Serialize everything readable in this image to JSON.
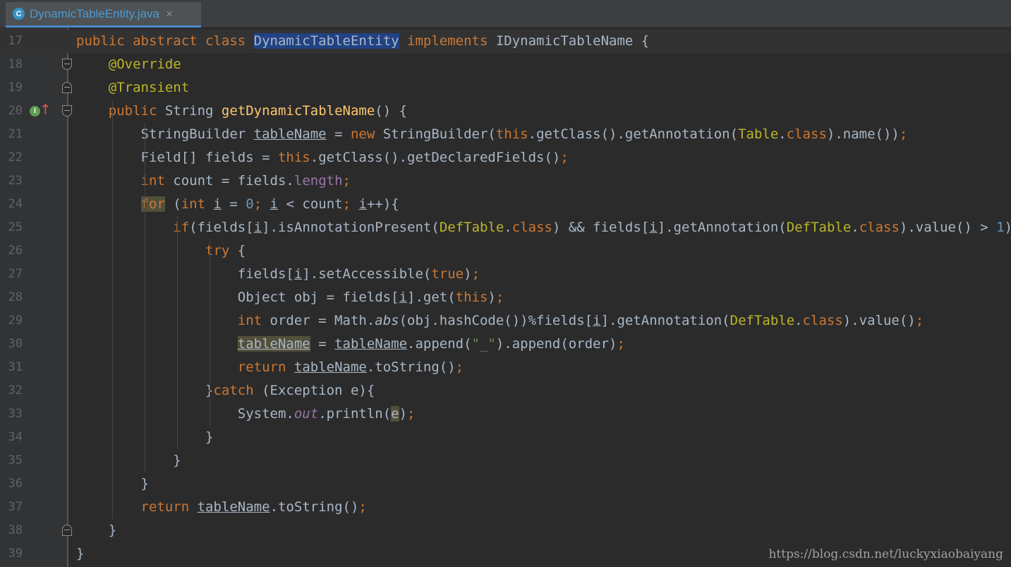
{
  "tab": {
    "icon": "C",
    "filename": "DynamicTableEntity.java",
    "close": "×"
  },
  "colors": {
    "keyword": "#cc7832",
    "annotation": "#bbb529",
    "method_declaration": "#ffc66d",
    "field": "#9876aa",
    "number": "#6897bb",
    "string": "#6a8759",
    "text": "#a9b7c6",
    "background": "#2b2b2b",
    "gutter": "#313335"
  },
  "gutter_icons": {
    "line_20": [
      "implements-interface-icon",
      "go-to-super-method-icon"
    ]
  },
  "watermark": "https://blog.csdn.net/luckyxiaobaiyang",
  "lines": [
    {
      "num": "17",
      "fold": null,
      "tokens": [
        [
          "kw",
          "public abstract class "
        ],
        [
          "hl",
          "DynamicTableEntity"
        ],
        [
          "t",
          " "
        ],
        [
          "kw",
          "implements"
        ],
        [
          "t",
          " IDynamicTableName {"
        ]
      ]
    },
    {
      "num": "18",
      "fold": "open",
      "tokens": [
        [
          "t",
          "    "
        ],
        [
          "ann",
          "@Override"
        ]
      ]
    },
    {
      "num": "19",
      "fold": "close",
      "tokens": [
        [
          "t",
          "    "
        ],
        [
          "ann",
          "@Transient"
        ]
      ]
    },
    {
      "num": "20",
      "fold": "open",
      "tokens": [
        [
          "t",
          "    "
        ],
        [
          "kw",
          "public"
        ],
        [
          "t",
          " String "
        ],
        [
          "mdecl",
          "getDynamicTableName"
        ],
        [
          "t",
          "() {"
        ]
      ]
    },
    {
      "num": "21",
      "fold": null,
      "tokens": [
        [
          "t",
          "        StringBuilder "
        ],
        [
          "ul",
          "tableName"
        ],
        [
          "t",
          " = "
        ],
        [
          "kw",
          "new"
        ],
        [
          "t",
          " StringBuilder("
        ],
        [
          "kw",
          "this"
        ],
        [
          "t",
          ".getClass().getAnnotation("
        ],
        [
          "ann",
          "Table"
        ],
        [
          "t",
          "."
        ],
        [
          "kw",
          "class"
        ],
        [
          "t",
          ").name())"
        ],
        [
          "kw",
          ";"
        ]
      ]
    },
    {
      "num": "22",
      "fold": null,
      "tokens": [
        [
          "t",
          "        Field[] fields = "
        ],
        [
          "kw",
          "this"
        ],
        [
          "t",
          ".getClass().getDeclaredFields()"
        ],
        [
          "kw",
          ";"
        ]
      ]
    },
    {
      "num": "23",
      "fold": null,
      "tokens": [
        [
          "t",
          "        "
        ],
        [
          "kw",
          "int"
        ],
        [
          "t",
          " count = fields."
        ],
        [
          "fld",
          "length"
        ],
        [
          "kw",
          ";"
        ]
      ]
    },
    {
      "num": "24",
      "fold": null,
      "tokens": [
        [
          "t",
          "        "
        ],
        [
          "kwocc",
          "for"
        ],
        [
          "t",
          " ("
        ],
        [
          "kw",
          "int"
        ],
        [
          "t",
          " "
        ],
        [
          "ul",
          "i"
        ],
        [
          "t",
          " = "
        ],
        [
          "num",
          "0"
        ],
        [
          "kw",
          "; "
        ],
        [
          "ul",
          "i"
        ],
        [
          "t",
          " < count"
        ],
        [
          "kw",
          "; "
        ],
        [
          "ul",
          "i"
        ],
        [
          "t",
          "++){"
        ]
      ]
    },
    {
      "num": "25",
      "fold": null,
      "tokens": [
        [
          "t",
          "            "
        ],
        [
          "kw",
          "if"
        ],
        [
          "t",
          "(fields["
        ],
        [
          "ul",
          "i"
        ],
        [
          "t",
          "].isAnnotationPresent("
        ],
        [
          "ann",
          "DefTable"
        ],
        [
          "t",
          "."
        ],
        [
          "kw",
          "class"
        ],
        [
          "t",
          ") && fields["
        ],
        [
          "ul",
          "i"
        ],
        [
          "t",
          "].getAnnotation("
        ],
        [
          "ann",
          "DefTable"
        ],
        [
          "t",
          "."
        ],
        [
          "kw",
          "class"
        ],
        [
          "t",
          ").value() > "
        ],
        [
          "num",
          "1"
        ],
        [
          "t",
          "){"
        ]
      ]
    },
    {
      "num": "26",
      "fold": null,
      "tokens": [
        [
          "t",
          "                "
        ],
        [
          "kw",
          "try"
        ],
        [
          "t",
          " {"
        ]
      ]
    },
    {
      "num": "27",
      "fold": null,
      "tokens": [
        [
          "t",
          "                    fields["
        ],
        [
          "ul",
          "i"
        ],
        [
          "t",
          "].setAccessible("
        ],
        [
          "kw",
          "true"
        ],
        [
          "t",
          ")"
        ],
        [
          "kw",
          ";"
        ]
      ]
    },
    {
      "num": "28",
      "fold": null,
      "tokens": [
        [
          "t",
          "                    Object obj = fields["
        ],
        [
          "ul",
          "i"
        ],
        [
          "t",
          "].get("
        ],
        [
          "kw",
          "this"
        ],
        [
          "t",
          ")"
        ],
        [
          "kw",
          ";"
        ]
      ]
    },
    {
      "num": "29",
      "fold": null,
      "tokens": [
        [
          "t",
          "                    "
        ],
        [
          "kw",
          "int"
        ],
        [
          "t",
          " order = Math."
        ],
        [
          "smeth",
          "abs"
        ],
        [
          "t",
          "(obj.hashCode())%fields["
        ],
        [
          "ul",
          "i"
        ],
        [
          "t",
          "].getAnnotation("
        ],
        [
          "ann",
          "DefTable"
        ],
        [
          "t",
          "."
        ],
        [
          "kw",
          "class"
        ],
        [
          "t",
          ").value()"
        ],
        [
          "kw",
          ";"
        ]
      ]
    },
    {
      "num": "30",
      "fold": null,
      "tokens": [
        [
          "t",
          "                    "
        ],
        [
          "ulocc",
          "tableName"
        ],
        [
          "t",
          " = "
        ],
        [
          "ul",
          "tableName"
        ],
        [
          "t",
          ".append("
        ],
        [
          "str",
          "\"_\""
        ],
        [
          "t",
          ").append(order)"
        ],
        [
          "kw",
          ";"
        ]
      ]
    },
    {
      "num": "31",
      "fold": null,
      "tokens": [
        [
          "t",
          "                    "
        ],
        [
          "kw",
          "return"
        ],
        [
          "t",
          " "
        ],
        [
          "ul",
          "tableName"
        ],
        [
          "t",
          ".toString()"
        ],
        [
          "kw",
          ";"
        ]
      ]
    },
    {
      "num": "32",
      "fold": null,
      "tokens": [
        [
          "t",
          "                }"
        ],
        [
          "kw",
          "catch"
        ],
        [
          "t",
          " (Exception e){"
        ]
      ]
    },
    {
      "num": "33",
      "fold": null,
      "tokens": [
        [
          "t",
          "                    System."
        ],
        [
          "sfld",
          "out"
        ],
        [
          "t",
          ".println("
        ],
        [
          "occ",
          "e"
        ],
        [
          "t",
          ")"
        ],
        [
          "kw",
          ";"
        ]
      ]
    },
    {
      "num": "34",
      "fold": null,
      "tokens": [
        [
          "t",
          "                }"
        ]
      ]
    },
    {
      "num": "35",
      "fold": null,
      "tokens": [
        [
          "t",
          "            }"
        ]
      ]
    },
    {
      "num": "36",
      "fold": null,
      "tokens": [
        [
          "t",
          "        }"
        ]
      ]
    },
    {
      "num": "37",
      "fold": null,
      "tokens": [
        [
          "t",
          "        "
        ],
        [
          "kw",
          "return"
        ],
        [
          "t",
          " "
        ],
        [
          "ul",
          "tableName"
        ],
        [
          "t",
          ".toString()"
        ],
        [
          "kw",
          ";"
        ]
      ]
    },
    {
      "num": "38",
      "fold": "close",
      "tokens": [
        [
          "t",
          "    }"
        ]
      ]
    },
    {
      "num": "39",
      "fold": null,
      "tokens": [
        [
          "t",
          "}"
        ]
      ]
    }
  ]
}
